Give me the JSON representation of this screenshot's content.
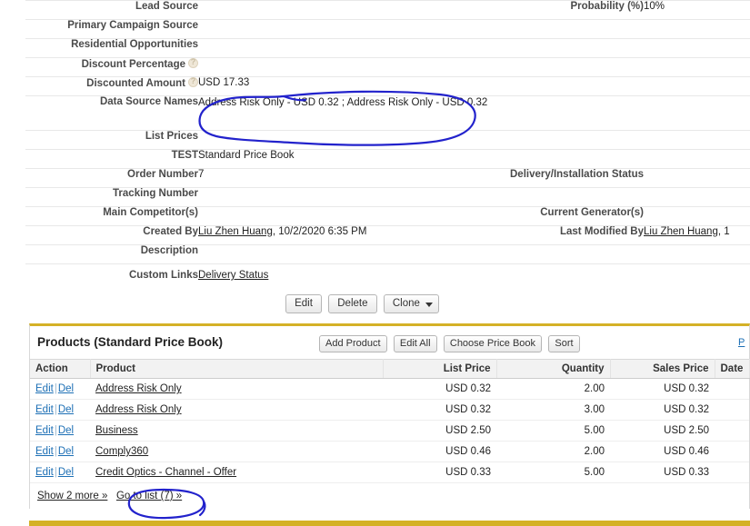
{
  "detail": {
    "left_fields": [
      {
        "label": "Lead Source",
        "value": "",
        "help": false
      },
      {
        "label": "Primary Campaign Source",
        "value": "",
        "help": false
      },
      {
        "label": "Residential Opportunities",
        "value": "",
        "help": false
      },
      {
        "label": "Discount Percentage",
        "value": "",
        "help": true
      },
      {
        "label": "Discounted Amount",
        "value": "USD 17.33",
        "help": true
      },
      {
        "label": "Data Source Names",
        "value": "Address Risk Only - USD 0.32 ; Address Risk Only - USD 0.32",
        "help": false
      },
      {
        "label": "List Prices",
        "value": "",
        "help": false
      },
      {
        "label": "TEST",
        "value": "Standard Price Book",
        "help": false
      },
      {
        "label": "Order Number",
        "value": "7",
        "help": false
      },
      {
        "label": "Tracking Number",
        "value": "",
        "help": false
      },
      {
        "label": "Main Competitor(s)",
        "value": "",
        "help": false
      },
      {
        "label": "Created By",
        "value": "Liu Zhen Huang, 10/2/2020 6:35 PM",
        "link_text": "Liu Zhen Huang",
        "rest": ", 10/2/2020 6:35 PM",
        "help": false
      },
      {
        "label": "Description",
        "value": "",
        "help": false
      },
      {
        "label": "Custom Links",
        "value": "Delivery Status",
        "is_link": true,
        "help": false
      }
    ],
    "right_fields": [
      {
        "label": "Probability (%)",
        "value": "10%"
      },
      {
        "label": "Delivery/Installation Status",
        "value": ""
      },
      {
        "label": "Current Generator(s)",
        "value": ""
      },
      {
        "label": "Last Modified By",
        "link_text": "Liu Zhen Huang",
        "rest": ", 1"
      }
    ]
  },
  "record_actions": {
    "edit": "Edit",
    "delete": "Delete",
    "clone": "Clone"
  },
  "products": {
    "title": "Products (Standard Price Book)",
    "buttons": {
      "add_product": "Add Product",
      "edit_all": "Edit All",
      "choose_price_book": "Choose Price Book",
      "sort": "Sort"
    },
    "help_link": "P",
    "columns": [
      "Action",
      "Product",
      "List Price",
      "Quantity",
      "Sales Price",
      "Date"
    ],
    "action_edit": "Edit",
    "action_sep": "|",
    "action_del": "Del",
    "rows": [
      {
        "product": "Address Risk Only",
        "list_price": "USD 0.32",
        "quantity": "2.00",
        "sales_price": "USD 0.32",
        "date": ""
      },
      {
        "product": "Address Risk Only",
        "list_price": "USD 0.32",
        "quantity": "3.00",
        "sales_price": "USD 0.32",
        "date": ""
      },
      {
        "product": "Business",
        "list_price": "USD 2.50",
        "quantity": "5.00",
        "sales_price": "USD 2.50",
        "date": ""
      },
      {
        "product": "Comply360",
        "list_price": "USD 0.46",
        "quantity": "2.00",
        "sales_price": "USD 0.46",
        "date": ""
      },
      {
        "product": "Credit Optics - Channel - Offer",
        "list_price": "USD 0.33",
        "quantity": "5.00",
        "sales_price": "USD 0.33",
        "date": ""
      }
    ],
    "footer": {
      "show_more": "Show 2 more »",
      "go_to_list": "Go to list (7) »"
    }
  },
  "annotations": {
    "color": "#2222cc",
    "marks": [
      {
        "name": "data-source-names-circle"
      },
      {
        "name": "go-to-list-circle"
      }
    ]
  }
}
